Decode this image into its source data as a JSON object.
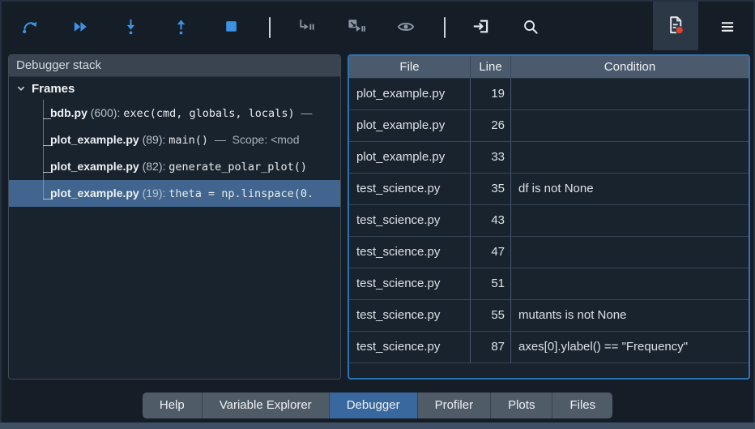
{
  "toolbar": {
    "icons": [
      "run-current-line",
      "continue-execution",
      "step-into",
      "step-return",
      "stop-debugging",
      "debug-file",
      "debug-cell",
      "show-output",
      "goto-editor",
      "search",
      "breakpoints-table",
      "options-menu"
    ],
    "breakpoints_toggle_active": true
  },
  "debugger_stack": {
    "title": "Debugger stack",
    "root_label": "Frames",
    "frames": [
      {
        "file": "bdb.py",
        "line_label": "(600):",
        "code": "exec(cmd, globals, locals)",
        "suffix": "—",
        "selected": false
      },
      {
        "file": "plot_example.py",
        "line_label": "(89):",
        "code": "main()",
        "suffix": "—  Scope: <mod",
        "selected": false
      },
      {
        "file": "plot_example.py",
        "line_label": "(82):",
        "code": "generate_polar_plot()",
        "suffix": "",
        "selected": false
      },
      {
        "file": "plot_example.py",
        "line_label": "(19):",
        "code": "theta = np.linspace(0.",
        "suffix": "",
        "selected": true
      }
    ]
  },
  "breakpoints_table": {
    "columns": [
      "File",
      "Line",
      "Condition"
    ],
    "rows": [
      {
        "file": "plot_example.py",
        "line": "19",
        "condition": ""
      },
      {
        "file": "plot_example.py",
        "line": "26",
        "condition": ""
      },
      {
        "file": "plot_example.py",
        "line": "33",
        "condition": ""
      },
      {
        "file": "test_science.py",
        "line": "35",
        "condition": "df is not None"
      },
      {
        "file": "test_science.py",
        "line": "43",
        "condition": ""
      },
      {
        "file": "test_science.py",
        "line": "47",
        "condition": ""
      },
      {
        "file": "test_science.py",
        "line": "51",
        "condition": ""
      },
      {
        "file": "test_science.py",
        "line": "55",
        "condition": "mutants is not None"
      },
      {
        "file": "test_science.py",
        "line": "87",
        "condition": "axes[0].ylabel() == \"Frequency\""
      }
    ]
  },
  "bottom_tabs": [
    {
      "label": "Help",
      "active": false
    },
    {
      "label": "Variable Explorer",
      "active": false
    },
    {
      "label": "Debugger",
      "active": true
    },
    {
      "label": "Profiler",
      "active": false
    },
    {
      "label": "Plots",
      "active": false
    },
    {
      "label": "Files",
      "active": false
    }
  ],
  "colors": {
    "icon_blue": "#3e92e4",
    "selection_blue": "#41658e",
    "active_tab_blue": "#39689f",
    "focus_border_blue": "#2c73b5",
    "breakpoint_red": "#e2432f",
    "header_slate": "#4c5a6d",
    "panel_bg": "#19232d"
  }
}
